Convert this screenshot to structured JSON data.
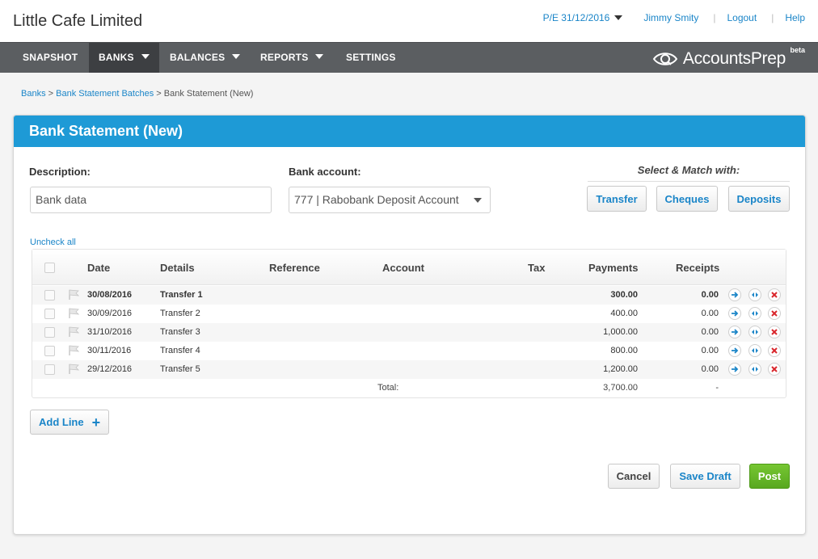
{
  "header": {
    "company": "Little Cafe Limited",
    "period": "P/E 31/12/2016",
    "user": "Jimmy Smity",
    "logout": "Logout",
    "help": "Help"
  },
  "nav": {
    "items": [
      {
        "label": "SNAPSHOT",
        "dropdown": false
      },
      {
        "label": "BANKS",
        "dropdown": true,
        "active": true
      },
      {
        "label": "BALANCES",
        "dropdown": true
      },
      {
        "label": "REPORTS",
        "dropdown": true
      },
      {
        "label": "SETTINGS",
        "dropdown": false
      }
    ],
    "brand": "AccountsPrep",
    "beta": "beta"
  },
  "breadcrumb": {
    "items": [
      "Banks",
      "Bank Statement Batches"
    ],
    "separator": ">",
    "current": "Bank Statement (New)"
  },
  "panel": {
    "title": "Bank Statement (New)"
  },
  "form": {
    "description_label": "Description:",
    "description_value": "Bank data",
    "bank_account_label": "Bank account:",
    "bank_account_value": "777 | Rabobank Deposit Account",
    "match_title": "Select & Match with:",
    "match_buttons": [
      "Transfer",
      "Cheques",
      "Deposits"
    ]
  },
  "table": {
    "uncheck_all": "Uncheck all",
    "columns": [
      "Date",
      "Details",
      "Reference",
      "Account",
      "Tax",
      "Payments",
      "Receipts"
    ],
    "rows": [
      {
        "date": "30/08/2016",
        "details": "Transfer 1",
        "reference": "",
        "account": "",
        "tax": "",
        "payments": "300.00",
        "receipts": "0.00"
      },
      {
        "date": "30/09/2016",
        "details": "Transfer 2",
        "reference": "",
        "account": "",
        "tax": "",
        "payments": "400.00",
        "receipts": "0.00"
      },
      {
        "date": "31/10/2016",
        "details": "Transfer 3",
        "reference": "",
        "account": "",
        "tax": "",
        "payments": "1,000.00",
        "receipts": "0.00"
      },
      {
        "date": "30/11/2016",
        "details": "Transfer 4",
        "reference": "",
        "account": "",
        "tax": "",
        "payments": "800.00",
        "receipts": "0.00"
      },
      {
        "date": "29/12/2016",
        "details": "Transfer 5",
        "reference": "",
        "account": "",
        "tax": "",
        "payments": "1,200.00",
        "receipts": "0.00"
      }
    ],
    "total_label": "Total:",
    "total_payments": "3,700.00",
    "total_receipts": "-"
  },
  "actions": {
    "add_line": "Add Line",
    "add_line_icon": "+",
    "cancel": "Cancel",
    "save_draft": "Save Draft",
    "post": "Post"
  },
  "colors": {
    "accent": "#1e9ad6",
    "link": "#1a85c8",
    "nav": "#5b5e61",
    "post": "#59a820",
    "delete": "#d9262c"
  }
}
